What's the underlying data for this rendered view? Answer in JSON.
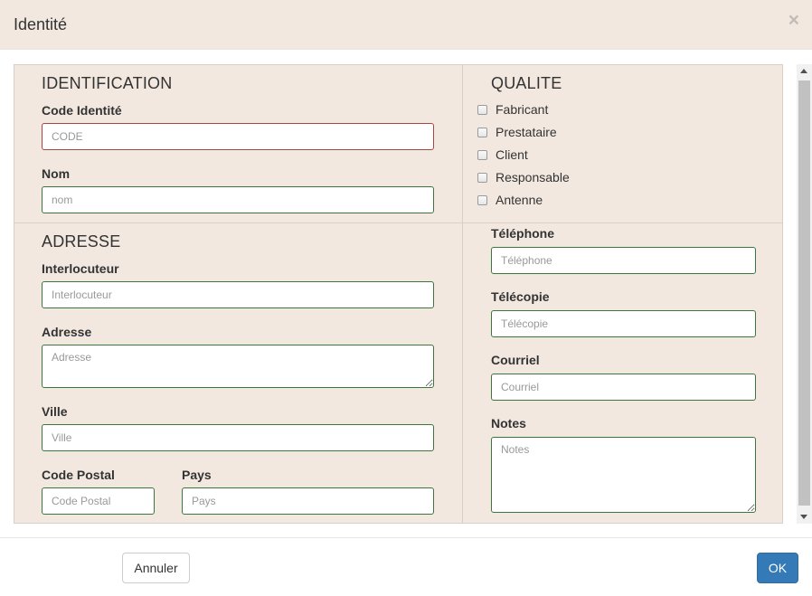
{
  "dialog": {
    "title": "Identité",
    "close_glyph": "×"
  },
  "identification": {
    "heading": "IDENTIFICATION",
    "code_label": "Code Identité",
    "code_placeholder": "CODE",
    "nom_label": "Nom",
    "nom_placeholder": "nom"
  },
  "qualite": {
    "heading": "QUALITE",
    "options": [
      "Fabricant",
      "Prestataire",
      "Client",
      "Responsable",
      "Antenne"
    ]
  },
  "adresse": {
    "heading": "ADRESSE",
    "interlocuteur_label": "Interlocuteur",
    "interlocuteur_placeholder": "Interlocuteur",
    "adresse_label": "Adresse",
    "adresse_placeholder": "Adresse",
    "ville_label": "Ville",
    "ville_placeholder": "Ville",
    "code_postal_label": "Code Postal",
    "code_postal_placeholder": "Code Postal",
    "pays_label": "Pays",
    "pays_placeholder": "Pays"
  },
  "contact": {
    "telephone_label": "Téléphone",
    "telephone_placeholder": "Téléphone",
    "telecopie_label": "Télécopie",
    "telecopie_placeholder": "Télécopie",
    "courriel_label": "Courriel",
    "courriel_placeholder": "Courriel",
    "notes_label": "Notes",
    "notes_placeholder": "Notes"
  },
  "footer": {
    "cancel_label": "Annuler",
    "ok_label": "OK"
  },
  "colors": {
    "panel_bg": "#f2e8e0",
    "valid_border": "#3c763d",
    "error_border": "#a94442",
    "primary": "#337ab7"
  }
}
